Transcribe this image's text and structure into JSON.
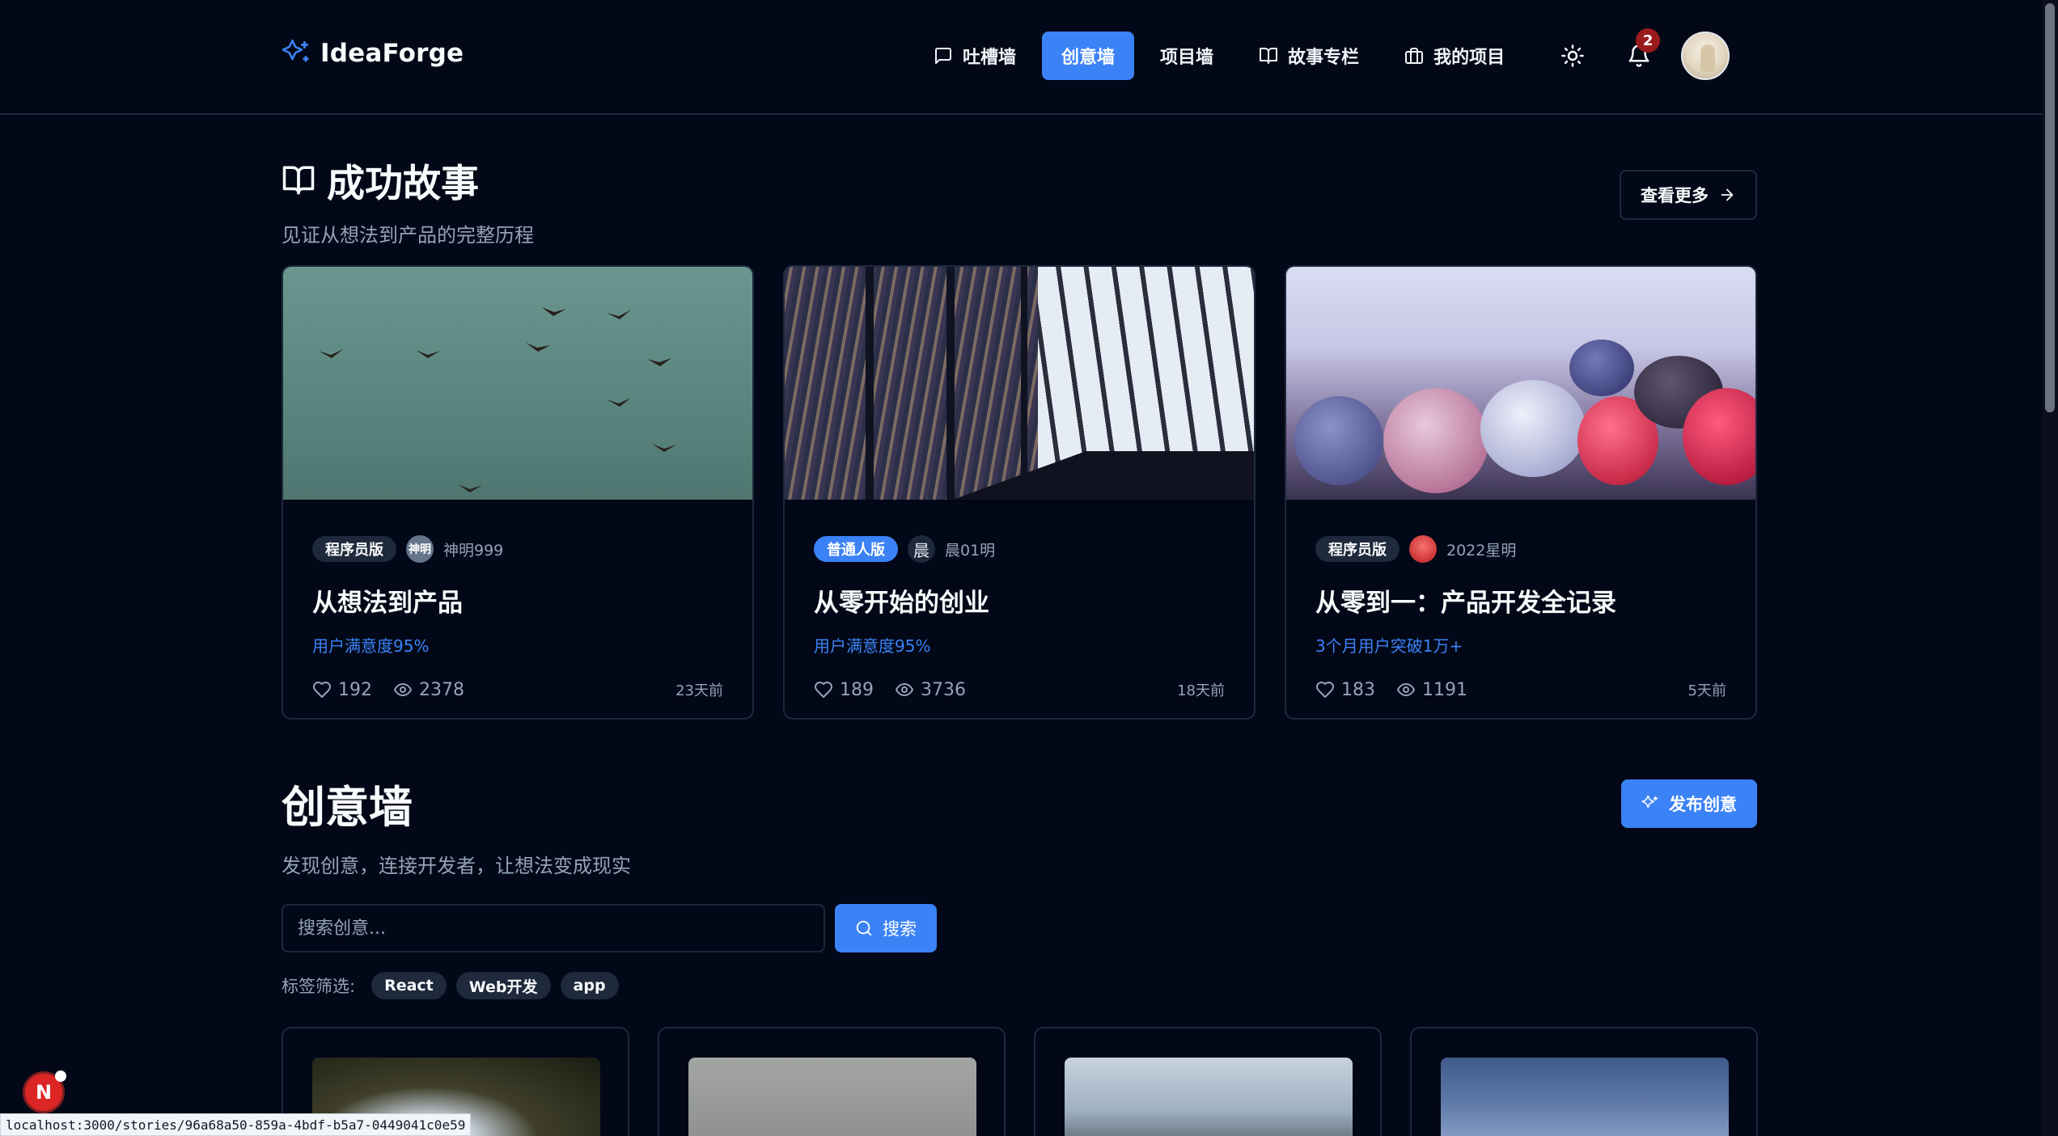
{
  "brand": {
    "name": "IdeaForge"
  },
  "nav": {
    "items": [
      {
        "label": "吐槽墙",
        "icon": "message-square-icon"
      },
      {
        "label": "创意墙",
        "icon": "",
        "active": true
      },
      {
        "label": "项目墙",
        "icon": ""
      },
      {
        "label": "故事专栏",
        "icon": "book-open-icon"
      },
      {
        "label": "我的项目",
        "icon": "briefcase-icon"
      }
    ],
    "notification_count": "2"
  },
  "stories": {
    "title": "成功故事",
    "subtitle": "见证从想法到产品的完整历程",
    "more_label": "查看更多",
    "cards": [
      {
        "tag": "程序员版",
        "tag_color": "#1e293b",
        "avatar_text": "神明",
        "author": "神明999",
        "title": "从想法到产品",
        "highlight": "用户满意度95%",
        "likes": "192",
        "views": "2378",
        "time": "23天前"
      },
      {
        "tag": "普通人版",
        "tag_color": "#3b82f6",
        "avatar_text": "晨",
        "author": "晨01明",
        "title": "从零开始的创业",
        "highlight": "用户满意度95%",
        "likes": "189",
        "views": "3736",
        "time": "18天前"
      },
      {
        "tag": "程序员版",
        "tag_color": "#1e293b",
        "avatar_text": "",
        "author": "2022星明",
        "title": "从零到一：产品开发全记录",
        "highlight": "3个月用户突破1万+",
        "likes": "183",
        "views": "1191",
        "time": "5天前"
      }
    ]
  },
  "ideas": {
    "title": "创意墙",
    "subtitle": "发现创意，连接开发者，让想法变成现实",
    "publish_label": "发布创意",
    "search_placeholder": "搜索创意...",
    "search_label": "搜索",
    "filter_label": "标签筛选:",
    "filter_tags": [
      "React",
      "Web开发",
      "app"
    ]
  },
  "status_bar": {
    "url": "localhost:3000/stories/96a68a50-859a-4bdf-b5a7-0449041c0e59"
  },
  "dev_badge": {
    "letter": "N"
  },
  "colors": {
    "background": "#020817",
    "accent": "#3b82f6",
    "border": "#1e293b",
    "muted": "#94a3b8"
  }
}
